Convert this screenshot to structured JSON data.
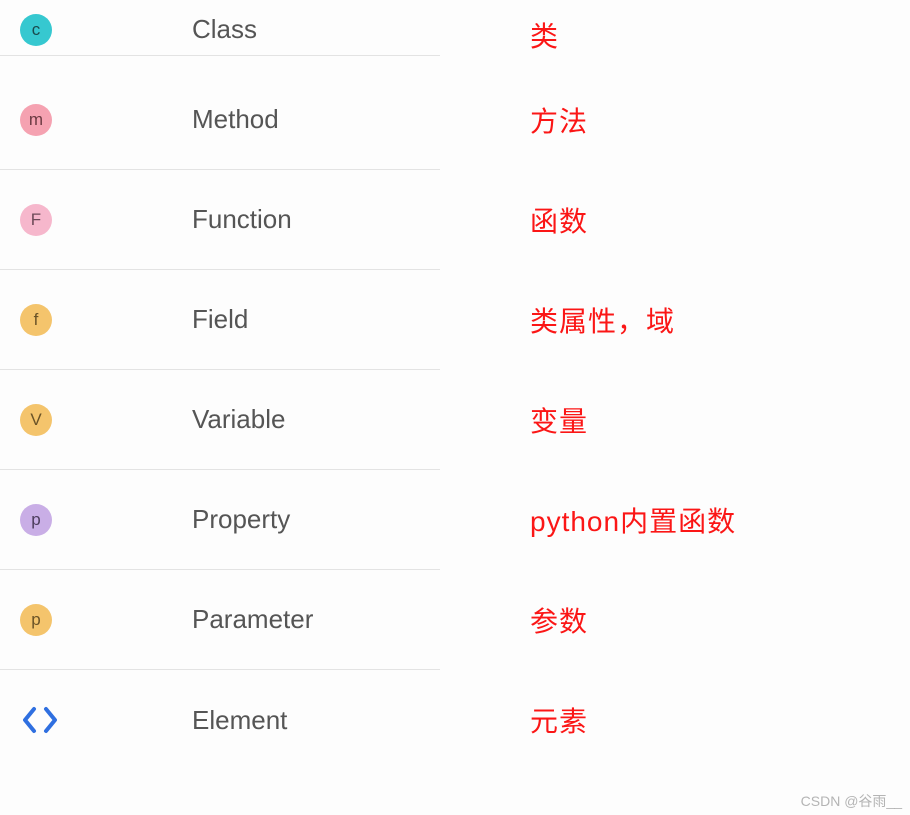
{
  "rows": [
    {
      "iconKey": "c",
      "iconLetter": "c",
      "iconBg": "#36c8d0",
      "iconColor": "#1a4a4d",
      "label": "Class",
      "translation": "类"
    },
    {
      "iconKey": "m",
      "iconLetter": "m",
      "iconBg": "#f5a2b1",
      "iconColor": "#6b3a42",
      "label": "Method",
      "translation": "方法"
    },
    {
      "iconKey": "F",
      "iconLetter": "F",
      "iconBg": "#f6b7cc",
      "iconColor": "#6d4a58",
      "label": "Function",
      "translation": "函数"
    },
    {
      "iconKey": "f",
      "iconLetter": "f",
      "iconBg": "#f4c46c",
      "iconColor": "#6a5327",
      "label": "Field",
      "translation": "类属性，域"
    },
    {
      "iconKey": "v",
      "iconLetter": "V",
      "iconBg": "#f4c46c",
      "iconColor": "#6a5327",
      "label": "Variable",
      "translation": "变量"
    },
    {
      "iconKey": "p1",
      "iconLetter": "p",
      "iconBg": "#c9aee6",
      "iconColor": "#4c3d5c",
      "label": "Property",
      "translation": "python内置函数"
    },
    {
      "iconKey": "p2",
      "iconLetter": "p",
      "iconBg": "#f4c46c",
      "iconColor": "#6a5327",
      "label": "Parameter",
      "translation": "参数"
    },
    {
      "iconKey": "element",
      "iconLetter": "<>",
      "iconBg": "",
      "iconColor": "#2f6fe0",
      "label": "Element",
      "translation": "元素"
    }
  ],
  "watermark": "CSDN @谷雨__"
}
